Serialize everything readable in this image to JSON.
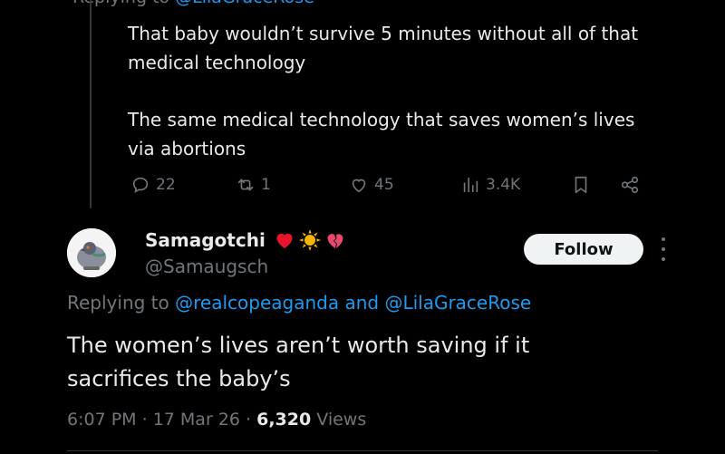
{
  "parent_tweet": {
    "replying_cut": {
      "prefix": "Replying to ",
      "mention": "@LilaGraceRose"
    },
    "lines": [
      "That baby wouldn’t survive 5 minutes without all of that",
      "medical technology",
      "The same medical technology that saves women’s lives",
      "via abortions"
    ],
    "actions": {
      "replies": "22",
      "reposts": "1",
      "likes": "45",
      "views": "3.4K"
    }
  },
  "main_tweet": {
    "display_name": "Samagotchi",
    "emojis": [
      "heart-red",
      "sun",
      "broken-heart"
    ],
    "handle": "@Samaugsch",
    "follow_label": "Follow",
    "replying_prefix": "Replying to ",
    "replying_mention_1": "@realcopeaganda",
    "replying_and": " and ",
    "replying_mention_2": "@LilaGraceRose",
    "text_lines": [
      "The women’s lives aren’t worth saving if it",
      "sacrifices the baby’s"
    ],
    "time": "6:07 PM",
    "sep1": " · ",
    "date": "17 Mar 26",
    "sep2": " · ",
    "views_count": "6,320",
    "views_label": " Views"
  },
  "colors": {
    "background": "#000000",
    "text": "#e7e9ea",
    "muted": "#71767b",
    "link": "#1d9bf0",
    "follow_bg": "#eff3f4"
  }
}
